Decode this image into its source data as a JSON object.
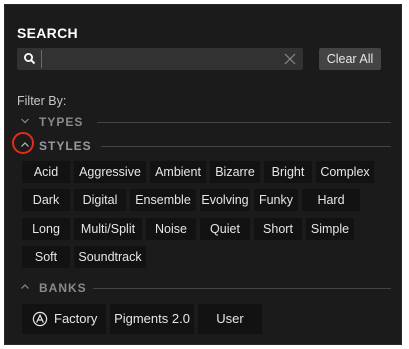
{
  "search": {
    "title": "SEARCH",
    "placeholder": "",
    "clear_all": "Clear All"
  },
  "filter_by": "Filter By:",
  "sections": {
    "types": "TYPES",
    "styles": "STYLES",
    "banks": "BANKS"
  },
  "styles": [
    [
      "Acid",
      "Aggressive",
      "Ambient",
      "Bizarre",
      "Bright",
      "Complex"
    ],
    [
      "Dark",
      "Digital",
      "Ensemble",
      "Evolving",
      "Funky",
      "Hard"
    ],
    [
      "Long",
      "Multi/Split",
      "Noise",
      "Quiet",
      "Short",
      "Simple"
    ],
    [
      "Soft",
      "Soundtrack"
    ]
  ],
  "banks": [
    "Factory",
    "Pigments 2.0",
    "User"
  ],
  "colors": {
    "panel": "#1b1b1b",
    "tag": "#121212",
    "highlight_ring": "#e62a1b"
  },
  "icons": [
    "search-icon",
    "close-icon",
    "chevron-down-icon",
    "chevron-up-icon",
    "arturia-logo-icon"
  ]
}
